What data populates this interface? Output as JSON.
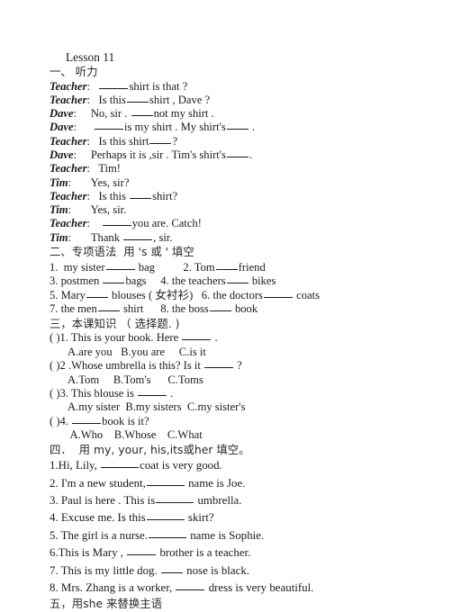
{
  "document": {
    "title": "Lesson 11"
  },
  "sections": {
    "one": {
      "heading": "一、 听力",
      "dialogue": [
        {
          "speaker": "Teacher",
          "pre": "   ",
          "text_a": "",
          "blank": "l",
          "text_b": "shirt is that ?"
        },
        {
          "speaker": "Teacher",
          "pre": "   ",
          "text_a": "Is this",
          "blank": "m",
          "text_b": "shirt , Dave ?"
        },
        {
          "speaker": "Dave",
          "pre": "     ",
          "text_a": "No, sir . ",
          "blank": "m",
          "text_b": "not my shirt ."
        },
        {
          "speaker": "Dave",
          "pre": "      ",
          "text_a": "",
          "blank": "l",
          "text_b": "is my shirt . My shirt's",
          "tail_blank": "m",
          "tail": " ."
        },
        {
          "speaker": "Teacher",
          "pre": "   ",
          "text_a": "Is this shirt",
          "blank": "m",
          "text_b": "?"
        },
        {
          "speaker": "Dave",
          "pre": "     ",
          "text_a": "Perhaps it is ,sir . Tim's shirt's",
          "blank": "m",
          "text_b": "."
        },
        {
          "speaker": "Teacher",
          "pre": "   ",
          "text_a": "Tim!",
          "blank": "",
          "text_b": ""
        },
        {
          "speaker": "Tim",
          "pre": "       ",
          "text_a": "Yes, sir?",
          "blank": "",
          "text_b": ""
        },
        {
          "speaker": "Teacher",
          "pre": "   ",
          "text_a": "Is this ",
          "blank": "m",
          "text_b": "shirt?"
        },
        {
          "speaker": "Tim",
          "pre": "       ",
          "text_a": "Yes, sir.",
          "blank": "",
          "text_b": ""
        },
        {
          "speaker": "Teacher",
          "pre": "    ",
          "text_a": "",
          "blank": "l",
          "text_b": "you are. Catch!"
        },
        {
          "speaker": "Tim",
          "pre": "       ",
          "text_a": "Thank ",
          "blank": "l",
          "text_b": ", sir."
        }
      ]
    },
    "two": {
      "heading": "二、专项语法  用 's 或 ' 填空",
      "items": [
        {
          "num": "1.",
          "text_a": "  my sister",
          "blank": "l",
          "text_b": " bag"
        },
        {
          "num": "2.",
          "text_a": " Tom",
          "blank": "m",
          "text_b": "friend"
        },
        {
          "num": "3.",
          "text_a": " postmen ",
          "blank": "m",
          "text_b": "bags"
        },
        {
          "num": "4.",
          "text_a": " the teachers",
          "blank": "m",
          "text_b": " bikes"
        },
        {
          "num": "5.",
          "text_a": " Mary",
          "blank": "m",
          "text_b": " blouses ( 女衬衫)"
        },
        {
          "num": "6.",
          "text_a": " the doctors",
          "blank": "l",
          "text_b": " coats"
        },
        {
          "num": "7.",
          "text_a": " the men",
          "blank": "m",
          "text_b": " shirt"
        },
        {
          "num": "8.",
          "text_a": " the boss",
          "blank": "m",
          "text_b": " book"
        }
      ]
    },
    "three": {
      "heading": "三，本课知识 （ 选择题. )",
      "questions": [
        {
          "stem_pre": "( )1. This is your book. Here ",
          "stem_blank": "l",
          "stem_post": " .",
          "options": "A.are you   B.you are     C.is it"
        },
        {
          "stem_pre": "( )2 .Whose umbrella is this? Is it ",
          "stem_blank": "l",
          "stem_post": " ?",
          "options": "A.Tom     B.Tom's      C.Toms"
        },
        {
          "stem_pre": "( )3. This blouse is ",
          "stem_blank": "l",
          "stem_post": " .",
          "options": "A.my sister  B.my sisters  C.my sister's"
        },
        {
          "stem_pre": "( )4. ",
          "stem_blank": "l",
          "stem_post": "book is it?",
          "options": " A.Who    B.Whose    C.What"
        }
      ]
    },
    "four": {
      "heading": "四．  用 my, your, his,its或her 填空。",
      "items": [
        {
          "pre": "1.Hi, Lily, ",
          "blank": "xl",
          "post": "coat is very good."
        },
        {
          "pre": "2. I'm a new student,",
          "blank": "xl",
          "post": " name is Joe."
        },
        {
          "pre": "3. Paul is here . This is",
          "blank": "xl",
          "post": " umbrella."
        },
        {
          "pre": "4. Excuse me. Is this",
          "blank": "xl",
          "post": " skirt?"
        },
        {
          "pre": "5. The girl is a nurse.",
          "blank": "xl",
          "post": " name is Sophie."
        },
        {
          "pre": "6.This is Mary , ",
          "blank": "l",
          "post": " brother is a teacher."
        },
        {
          "pre": "7. This is my little dog. ",
          "blank": "m",
          "post": " nose is black."
        },
        {
          "pre": "8. Mrs. Zhang is a worker, ",
          "blank": "l",
          "post": " dress is very beautiful."
        }
      ]
    },
    "five": {
      "heading": "五，用she 来替换主语"
    }
  }
}
